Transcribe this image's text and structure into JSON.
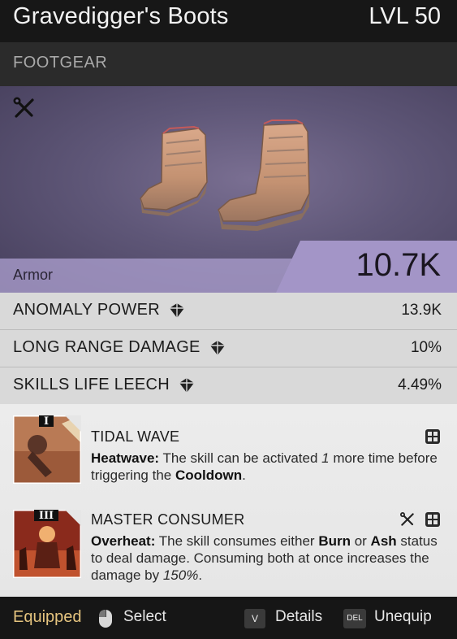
{
  "item": {
    "name": "Gravedigger's Boots",
    "level": "LVL 50",
    "category": "FOOTGEAR",
    "armor_label": "Armor",
    "armor_value": "10.7K"
  },
  "stats": [
    {
      "label": "ANOMALY POWER",
      "value": "13.9K"
    },
    {
      "label": "LONG RANGE DAMAGE",
      "value": "10%"
    },
    {
      "label": "SKILLS LIFE LEECH",
      "value": "4.49%"
    }
  ],
  "skills": [
    {
      "tier": "I",
      "title": "TIDAL WAVE",
      "effect": "Heatwave:",
      "desc_1": " The skill can be activated ",
      "desc_2": "1",
      "desc_3": " more time before triggering the ",
      "desc_4": "Cooldown",
      "desc_5": "."
    },
    {
      "tier": "III",
      "title": "MASTER CONSUMER",
      "effect": "Overheat:",
      "desc_1": " The skill consumes either ",
      "desc_2": "Burn",
      "desc_3": " or ",
      "desc_4": "Ash",
      "desc_5": " status to deal damage. Consuming both at once increases the damage by ",
      "desc_6": "150%",
      "desc_7": "."
    }
  ],
  "footer": {
    "status": "Equipped",
    "select": "Select",
    "details_key": "V",
    "details": "Details",
    "unequip_key": "DEL",
    "unequip": "Unequip"
  },
  "icons": {
    "crafting": "wrench-screwdriver-icon",
    "gem": "shard-icon",
    "grid": "grid-icon",
    "mouse": "mouse-icon"
  },
  "colors": {
    "equipped": "#e5c47f",
    "hero_bg": "#5f5778",
    "armor_band": "#a395c7"
  }
}
